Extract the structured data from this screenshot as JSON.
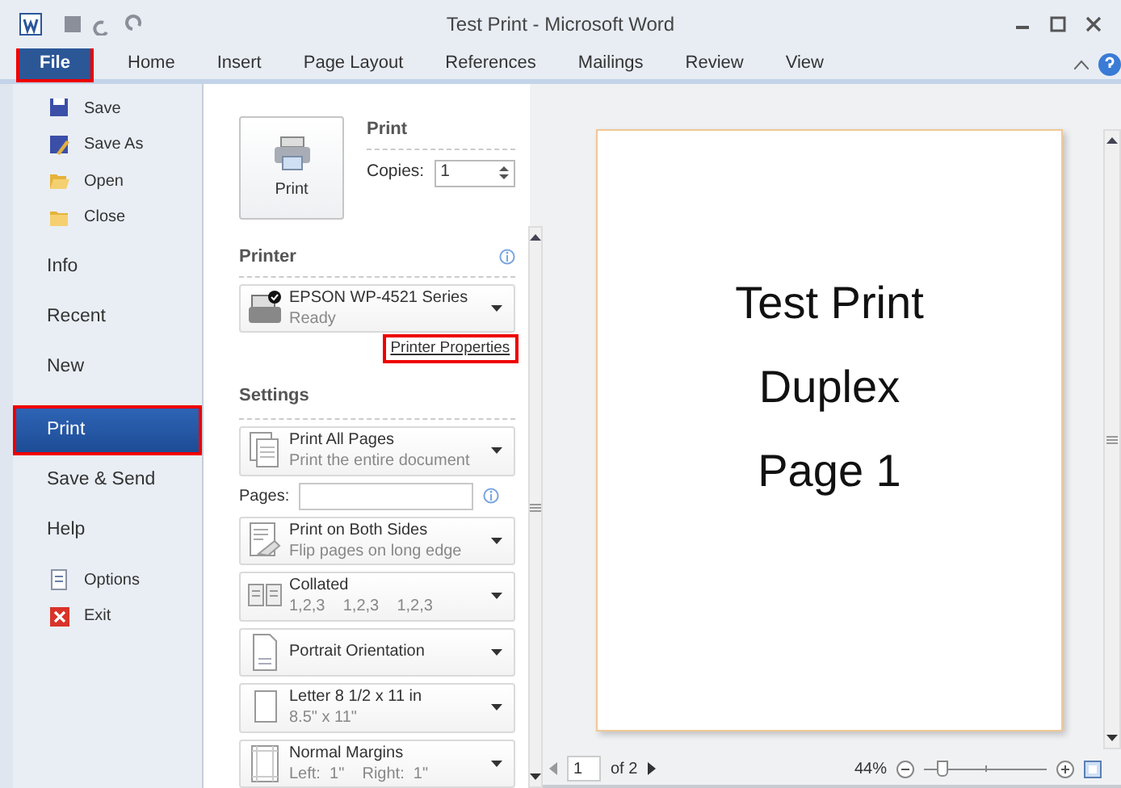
{
  "window": {
    "title": "Test Print - Microsoft Word"
  },
  "ribbon_tabs": [
    {
      "label": "File",
      "selected": true,
      "highlighted": true
    },
    {
      "label": "Home",
      "selected": false,
      "highlighted": false
    },
    {
      "label": "Insert",
      "selected": false,
      "highlighted": false
    },
    {
      "label": "Page Layout",
      "selected": false,
      "highlighted": false
    },
    {
      "label": "References",
      "selected": false,
      "highlighted": false
    },
    {
      "label": "Mailings",
      "selected": false,
      "highlighted": false
    },
    {
      "label": "Review",
      "selected": false,
      "highlighted": false
    },
    {
      "label": "View",
      "selected": false,
      "highlighted": false
    }
  ],
  "sidebar": {
    "items": [
      {
        "label": "Save",
        "kind": "small",
        "selected": false,
        "highlighted": false
      },
      {
        "label": "Save As",
        "kind": "small",
        "selected": false,
        "highlighted": false
      },
      {
        "label": "Open",
        "kind": "small",
        "selected": false,
        "highlighted": false
      },
      {
        "label": "Close",
        "kind": "small",
        "selected": false,
        "highlighted": false
      },
      {
        "label": "Info",
        "kind": "large",
        "selected": false,
        "highlighted": false
      },
      {
        "label": "Recent",
        "kind": "large",
        "selected": false,
        "highlighted": false
      },
      {
        "label": "New",
        "kind": "large",
        "selected": false,
        "highlighted": false
      },
      {
        "label": "Print",
        "kind": "large",
        "selected": true,
        "highlighted": true
      },
      {
        "label": "Save & Send",
        "kind": "large",
        "selected": false,
        "highlighted": false
      },
      {
        "label": "Help",
        "kind": "large",
        "selected": false,
        "highlighted": false
      },
      {
        "label": "Options",
        "kind": "small",
        "selected": false,
        "highlighted": false
      },
      {
        "label": "Exit",
        "kind": "small",
        "selected": false,
        "highlighted": false
      }
    ]
  },
  "print": {
    "button": "Print",
    "heading": "Print",
    "copies_label": "Copies:",
    "copies": "1"
  },
  "printer": {
    "heading": "Printer",
    "name": "EPSON WP-4521 Series",
    "status": "Ready",
    "properties_link": "Printer Properties",
    "link_highlighted": true
  },
  "settings": {
    "heading": "Settings",
    "pages_label": "Pages:",
    "options": [
      {
        "title": "Print All Pages",
        "subtitle": "Print the entire document"
      },
      {
        "title": "Print on Both Sides",
        "subtitle": "Flip pages on long edge"
      },
      {
        "title": "Collated",
        "subtitle": "1,2,3    1,2,3    1,2,3"
      },
      {
        "title": "Portrait Orientation"
      },
      {
        "title": "Letter 8 1/2 x 11 in",
        "subtitle": "8.5\" x 11\""
      },
      {
        "title": "Normal Margins",
        "subtitle": "Left:  1\"    Right:  1\""
      }
    ]
  },
  "preview": {
    "lines": [
      "Test Print",
      "Duplex",
      "Page 1"
    ],
    "page": "1",
    "page_count": "of 2",
    "zoom": "44%",
    "zoom_level": {
      "level": 0.15
    }
  }
}
